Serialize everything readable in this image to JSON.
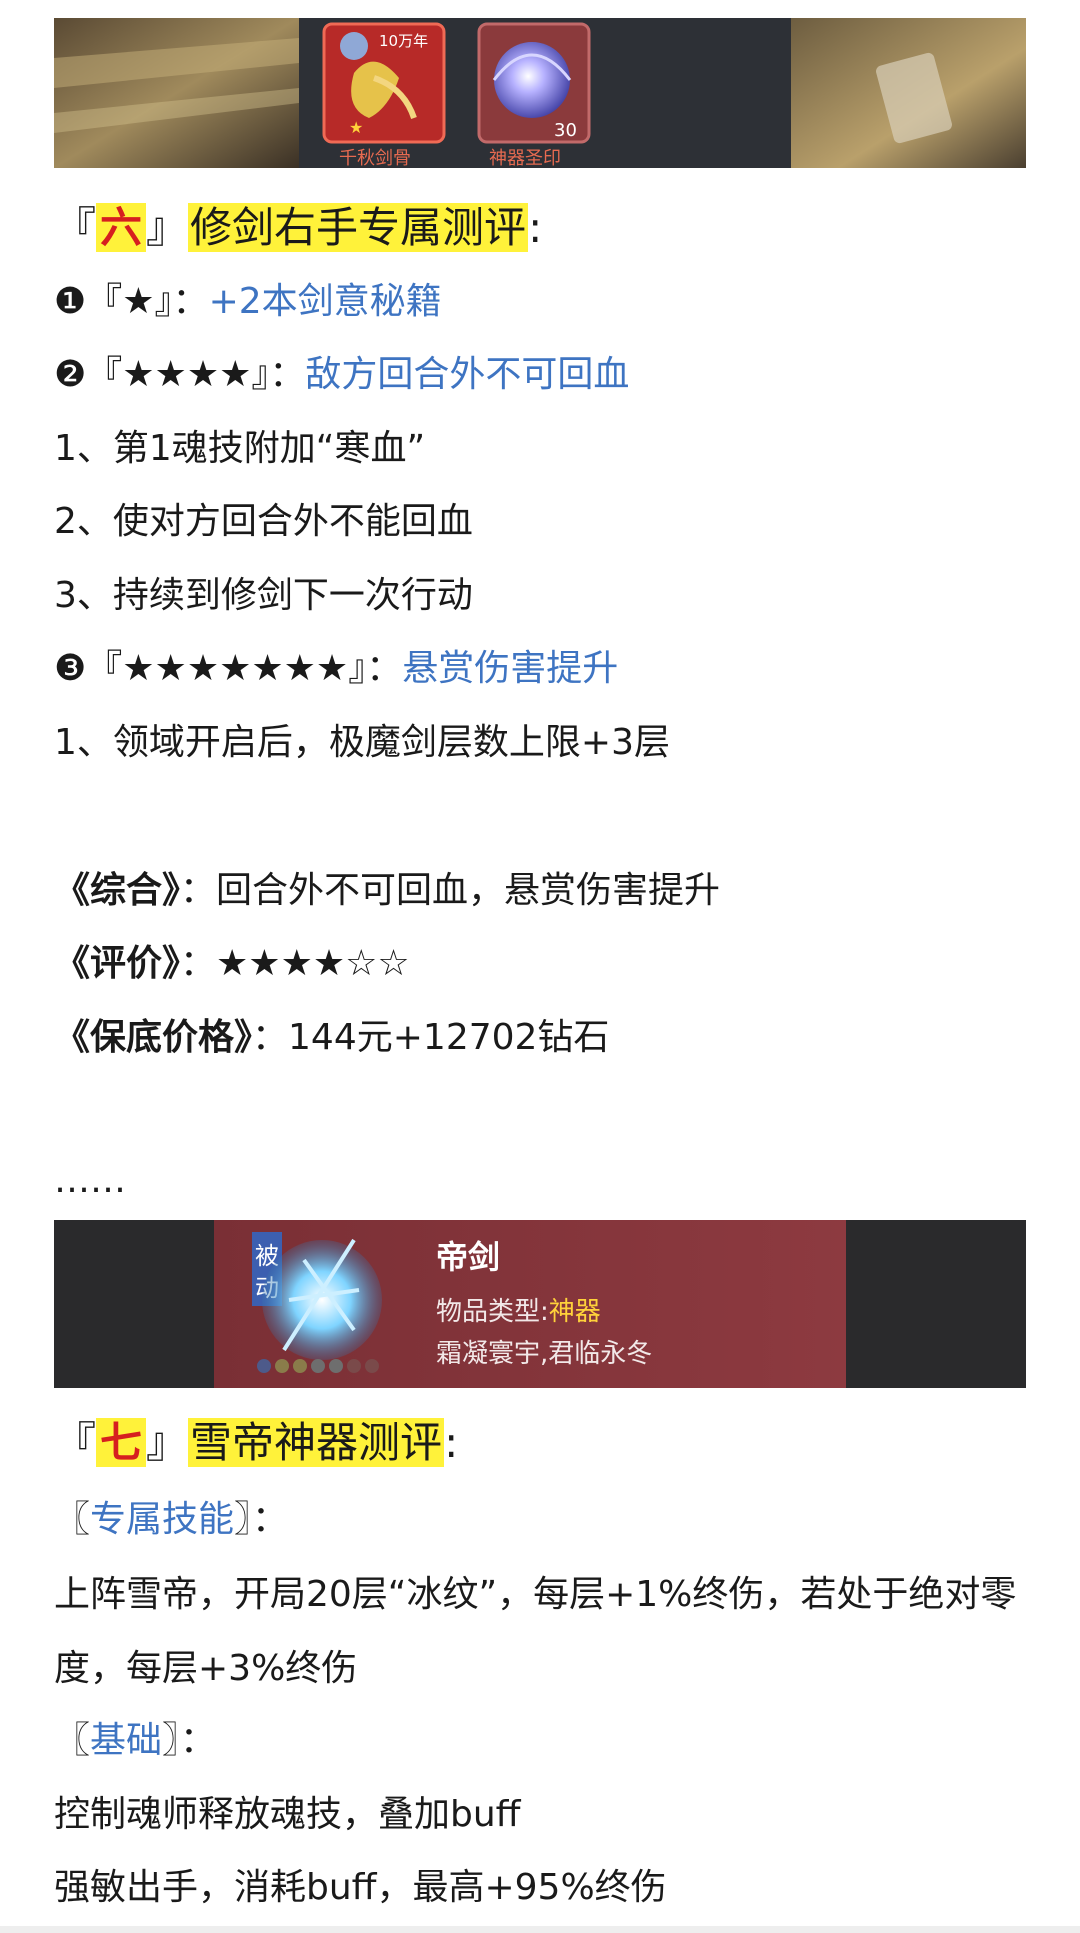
{
  "banner1": {
    "card1_badge": "10万年",
    "card1_label": "千秋剑骨",
    "card2_count": "30",
    "card2_label": "神器圣印"
  },
  "sec6": {
    "open": "『",
    "num": "六",
    "close": "』",
    "title": "修剑右手专属测评",
    "colon": ":"
  },
  "stars": {
    "s1_mark": "❶『★』：",
    "s1_value": "+2本剑意秘籍",
    "s2_mark": "❷『★★★★』：",
    "s2_value": "敌方回合外不可回血",
    "s2_items": [
      "1、第1魂技附加“寒血”",
      "2、使对方回合外不能回血",
      "3、持续到修剑下一次行动"
    ],
    "s3_mark": "❸『★★★★★★★』：",
    "s3_value": "悬赏伤害提升",
    "s3_items": [
      "1、领域开启后，极魔剑层数上限+3层"
    ]
  },
  "summary": {
    "l1_label": "《综合》",
    "l1_sep": "：",
    "l1_value": "回合外不可回血，悬赏伤害提升",
    "l2_label": "《评价》",
    "l2_sep": "：",
    "l2_value": "★★★★☆☆",
    "l3_label": "《保底价格》",
    "l3_sep": "：",
    "l3_value": "144元+12702钻石"
  },
  "ellipsis": "……",
  "banner2": {
    "tag_line1": "被",
    "tag_line2": "动",
    "name": "帝剑",
    "type_label": "物品类型:",
    "type_value": "神器",
    "desc": "霜凝寰宇,君临永冬"
  },
  "sec7": {
    "open": "『",
    "num": "七",
    "close": "』",
    "title": "雪帝神器测评",
    "colon": ":"
  },
  "skill": {
    "open": "〖",
    "label": "专属技能",
    "close": "〗：",
    "text": "上阵雪帝，开局20层“冰纹”，每层+1%终伤，若处于绝对零度，每层+3%终伤"
  },
  "base": {
    "open": "〖",
    "label": "基础",
    "close": "〗：",
    "line1": "控制魂师释放魂技，叠加buff",
    "line2": "强敏出手，消耗buff，最高+95%终伤"
  },
  "colors": {
    "highlight": "#fff23a",
    "number_red": "#d61f1f",
    "link_blue": "#3e74c2"
  }
}
